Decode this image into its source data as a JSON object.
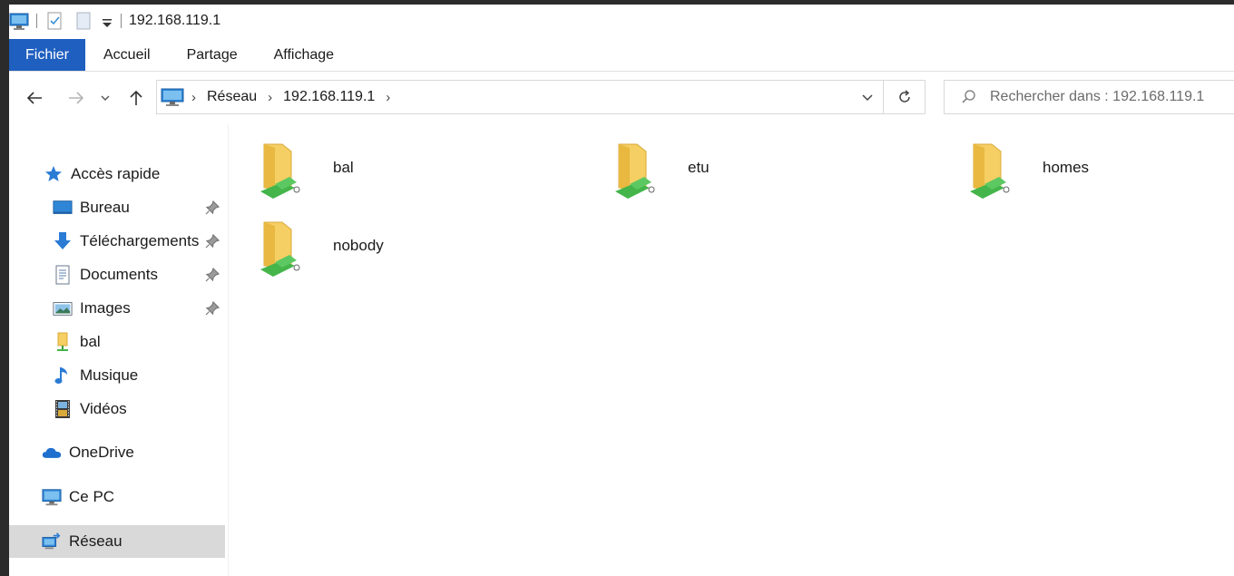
{
  "window": {
    "title": "192.168.119.1"
  },
  "ribbon": {
    "tabs": [
      "Fichier",
      "Accueil",
      "Partage",
      "Affichage"
    ]
  },
  "nav": {
    "breadcrumb": [
      "Réseau",
      "192.168.119.1"
    ],
    "search_placeholder": "Rechercher dans : 192.168.119.1"
  },
  "sidebar": {
    "quick_access": "Accès rapide",
    "items": [
      "Bureau",
      "Téléchargements",
      "Documents",
      "Images",
      "bal",
      "Musique",
      "Vidéos"
    ],
    "onedrive": "OneDrive",
    "thispc": "Ce PC",
    "network": "Réseau"
  },
  "shares": [
    "bal",
    "etu",
    "homes",
    "nobody"
  ],
  "colors": {
    "accent": "#1f5fbf",
    "folder": "#f5cf63",
    "share": "#44b54a",
    "selected": "#d9d9d9"
  }
}
